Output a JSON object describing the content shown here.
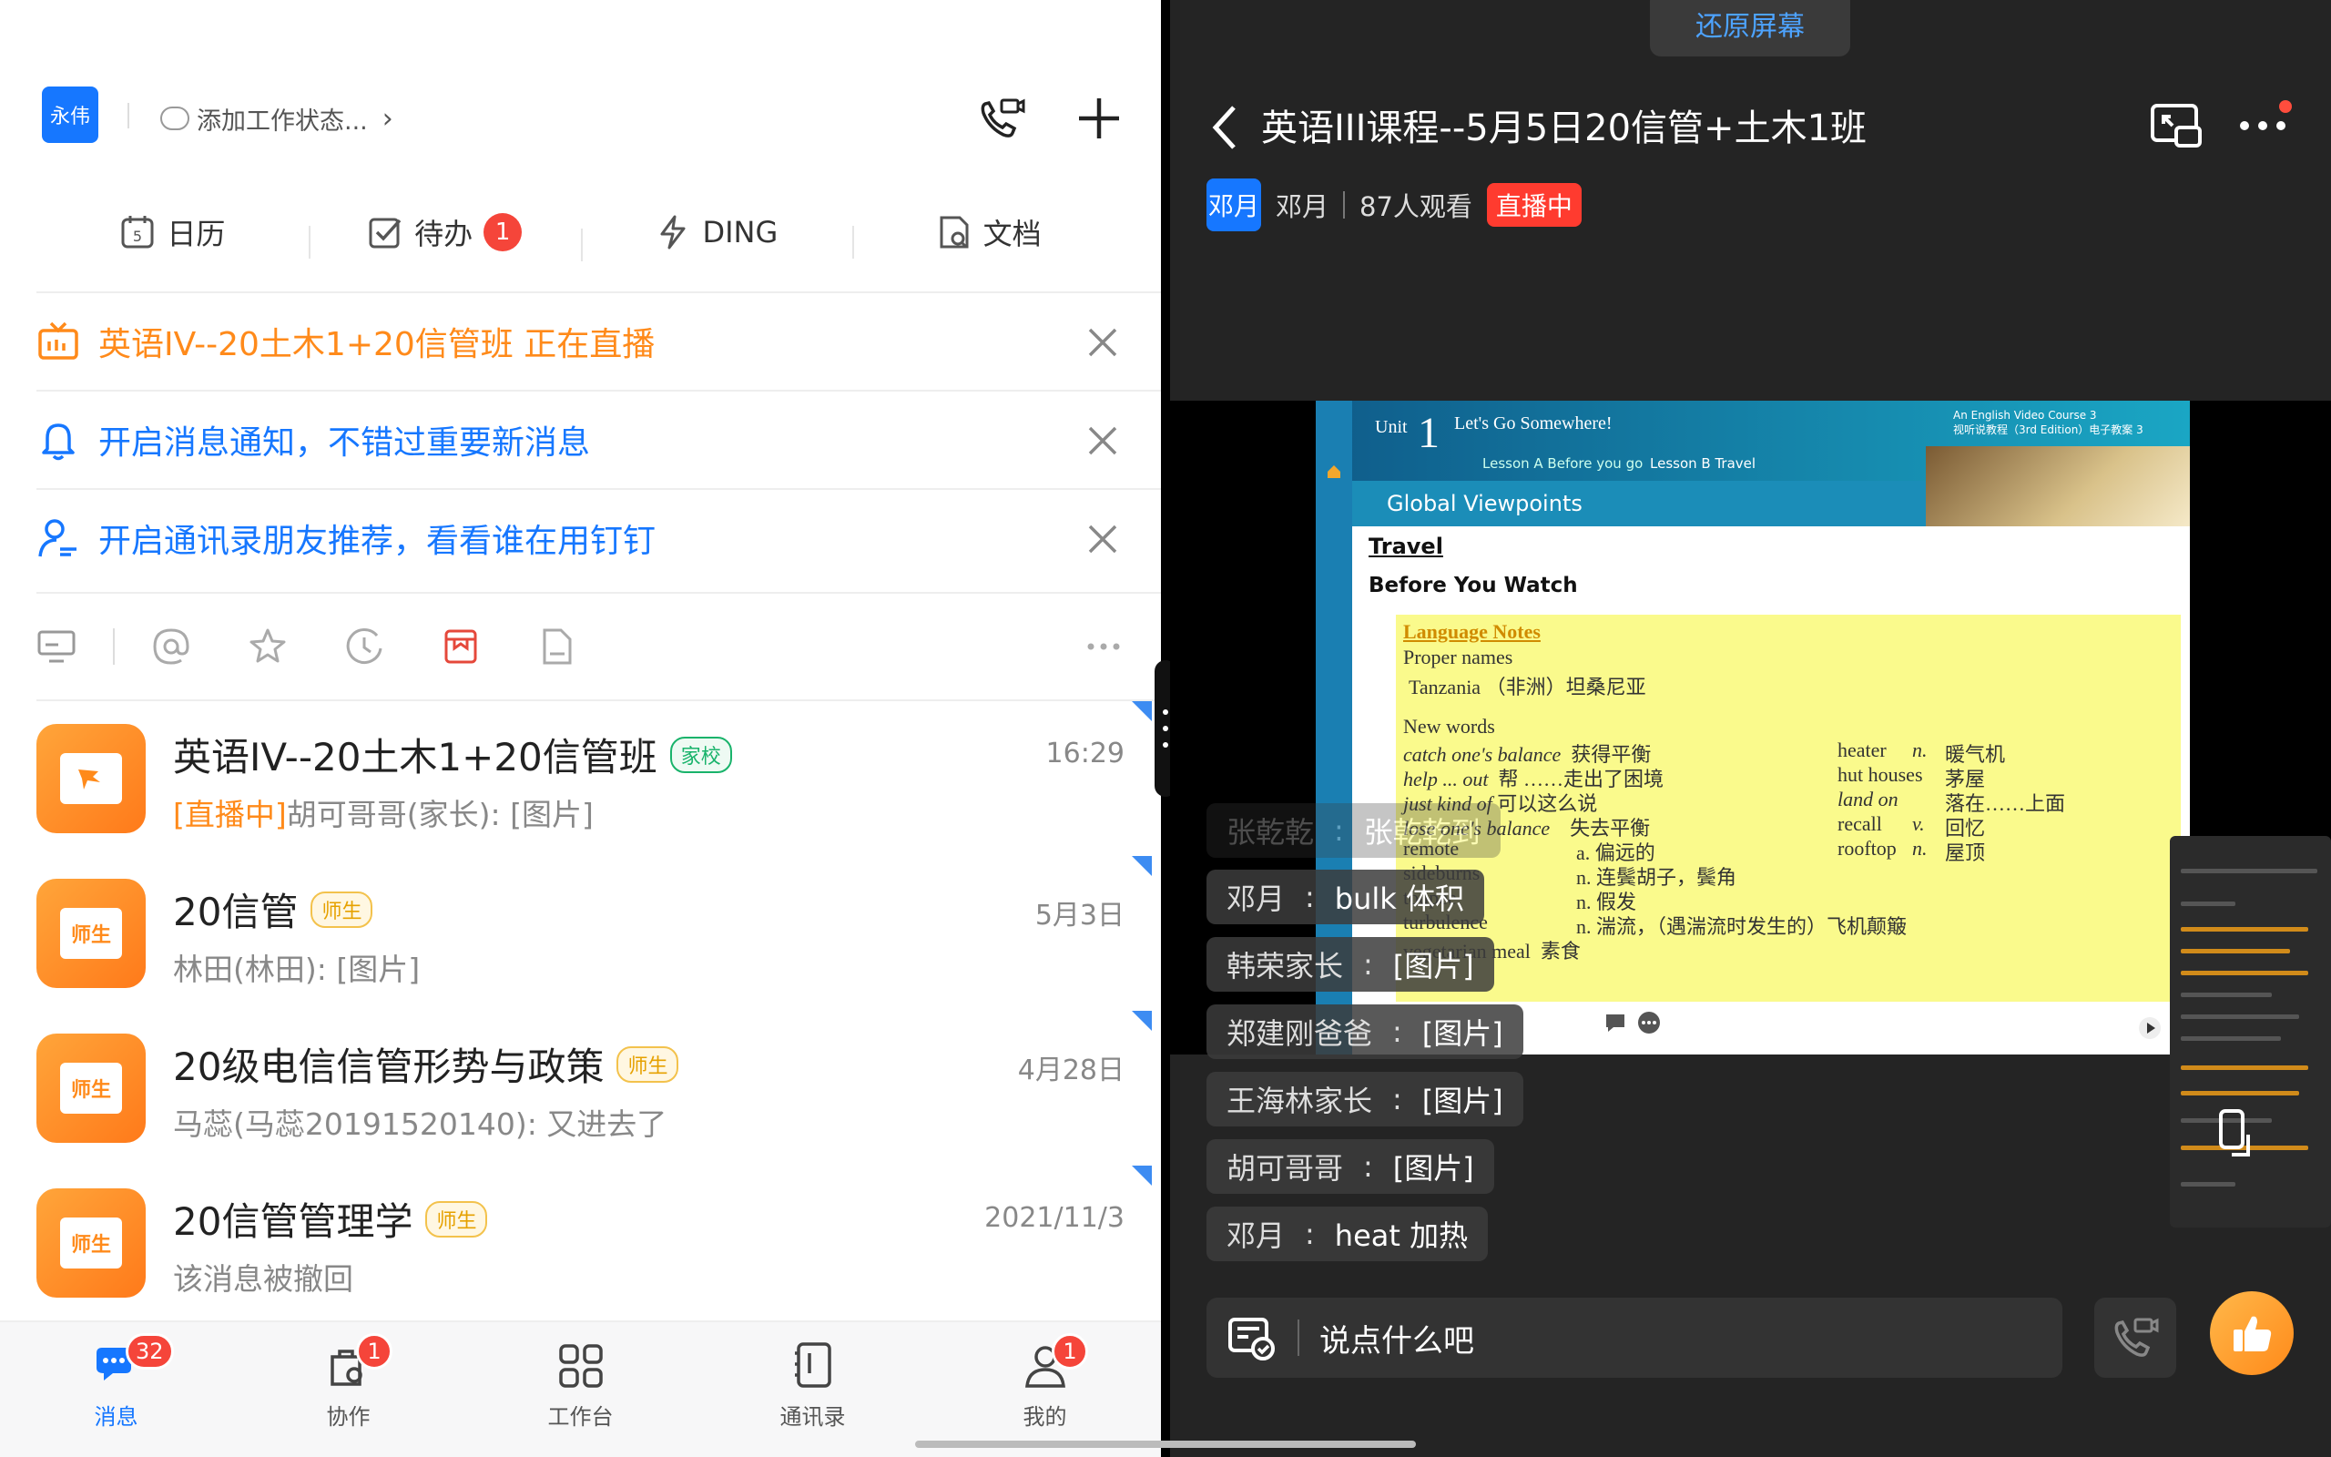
{
  "left": {
    "user_avatar_text": "永伟",
    "status_placeholder": "添加工作状态...",
    "quick_actions": [
      {
        "label": "日历",
        "icon": "calendar-icon"
      },
      {
        "label": "待办",
        "icon": "todo-check-icon",
        "badge": "1"
      },
      {
        "label": "DING",
        "icon": "lightning-icon"
      },
      {
        "label": "文档",
        "icon": "document-icon"
      }
    ],
    "notices": [
      {
        "text": "英语IV--20土木1+20信管班 正在直播",
        "color": "#ff8a1a",
        "icon": "live-tv-icon"
      },
      {
        "text": "开启消息通知，不错过重要新消息",
        "color": "#1677ff",
        "icon": "bell-icon"
      },
      {
        "text": "开启通讯录朋友推荐，看看谁在用钉钉",
        "color": "#1677ff",
        "icon": "contact-recommend-icon"
      }
    ],
    "chats": [
      {
        "title": "英语IV--20土木1+20信管班",
        "tag": "家校",
        "tag_style": "green",
        "time": "16:29",
        "preview_prefix": "[直播中]",
        "preview": "胡可哥哥(家长): [图片]",
        "logo_text": ""
      },
      {
        "title": "20信管",
        "tag": "师生",
        "tag_style": "yellow",
        "time": "5月3日",
        "preview_prefix": "",
        "preview": "林田(林田): [图片]",
        "logo_text": "师生"
      },
      {
        "title": "20级电信信管形势与政策",
        "tag": "师生",
        "tag_style": "yellow",
        "time": "4月28日",
        "preview_prefix": "",
        "preview": "马蕊(马蕊20191520140): 又进去了",
        "logo_text": "师生"
      },
      {
        "title": "20信管管理学",
        "tag": "师生",
        "tag_style": "yellow",
        "time": "2021/11/3",
        "preview_prefix": "",
        "preview": "该消息被撤回",
        "logo_text": "师生"
      }
    ],
    "tabs": [
      {
        "label": "消息",
        "badge": "32",
        "active": true,
        "icon": "message-icon"
      },
      {
        "label": "协作",
        "badge": "1",
        "active": false,
        "icon": "collaborate-icon"
      },
      {
        "label": "工作台",
        "badge": "",
        "active": false,
        "icon": "workbench-grid-icon"
      },
      {
        "label": "通讯录",
        "badge": "",
        "active": false,
        "icon": "contacts-icon"
      },
      {
        "label": "我的",
        "badge": "1",
        "active": false,
        "icon": "profile-icon"
      }
    ]
  },
  "right": {
    "restore_label": "还原屏幕",
    "title": "英语III课程--5月5日20信管+土木1班",
    "host_avatar": "邓月",
    "host_name": "邓月",
    "viewers": "87人观看",
    "live_badge": "直播中",
    "slide": {
      "unit_label": "Unit",
      "unit_num": "1",
      "unit_title": "Let's Go Somewhere!",
      "lesson_a": "Lesson A  Before you go",
      "lesson_b": "Lesson B Travel",
      "course_line1": "An English Video Course 3",
      "course_line2": "视听说教程（3rd Edition）电子教案 3",
      "section": "Global Viewpoints",
      "heading": "Travel",
      "subheading": "Before You Watch",
      "notes_title": "Language Notes",
      "proper_names": "Proper names",
      "tanzania": "Tanzania （非洲）坦桑尼亚",
      "new_words": "New words",
      "words_left": [
        {
          "en": "catch one's balance",
          "zh": "获得平衡"
        },
        {
          "en": "help ... out",
          "zh": "帮 ……走出了困境"
        },
        {
          "en": "just kind of",
          "zh": "可以这么说"
        },
        {
          "en": "lose one's balance",
          "zh": "失去平衡"
        },
        {
          "en": "remote",
          "zh": "a. 偏远的"
        },
        {
          "en": "sideburns",
          "zh": "n. 连鬓胡子，鬓角"
        },
        {
          "en": "toupee",
          "zh": "n. 假发"
        },
        {
          "en": "turbulence",
          "zh": "n. 湍流，（遇湍流时发生的）飞机颠簸"
        },
        {
          "en": "vegetarian meal",
          "zh": "素食"
        }
      ],
      "words_right": [
        {
          "en": "heater",
          "pos": "n.",
          "zh": "暖气机"
        },
        {
          "en": "hut houses",
          "pos": "",
          "zh": "茅屋"
        },
        {
          "en": "land on",
          "pos": "",
          "zh": "落在……上面"
        },
        {
          "en": "recall",
          "pos": "v.",
          "zh": "回忆"
        },
        {
          "en": "rooftop",
          "pos": "n.",
          "zh": "屋顶"
        }
      ]
    },
    "danmaku": [
      {
        "user": "张乾乾",
        "msg": "张乾乾到",
        "faded": true
      },
      {
        "user": "邓月",
        "msg": "bulk    体积",
        "faded": false
      },
      {
        "user": "韩荣家长",
        "msg": "[图片]",
        "faded": false
      },
      {
        "user": "郑建刚爸爸",
        "msg": "[图片]",
        "faded": false
      },
      {
        "user": "王海林家长",
        "msg": "[图片]",
        "faded": false
      },
      {
        "user": "胡可哥哥",
        "msg": "[图片]",
        "faded": false
      },
      {
        "user": "邓月",
        "msg": "heat     加热",
        "faded": false
      }
    ],
    "input_placeholder": "说点什么吧"
  }
}
